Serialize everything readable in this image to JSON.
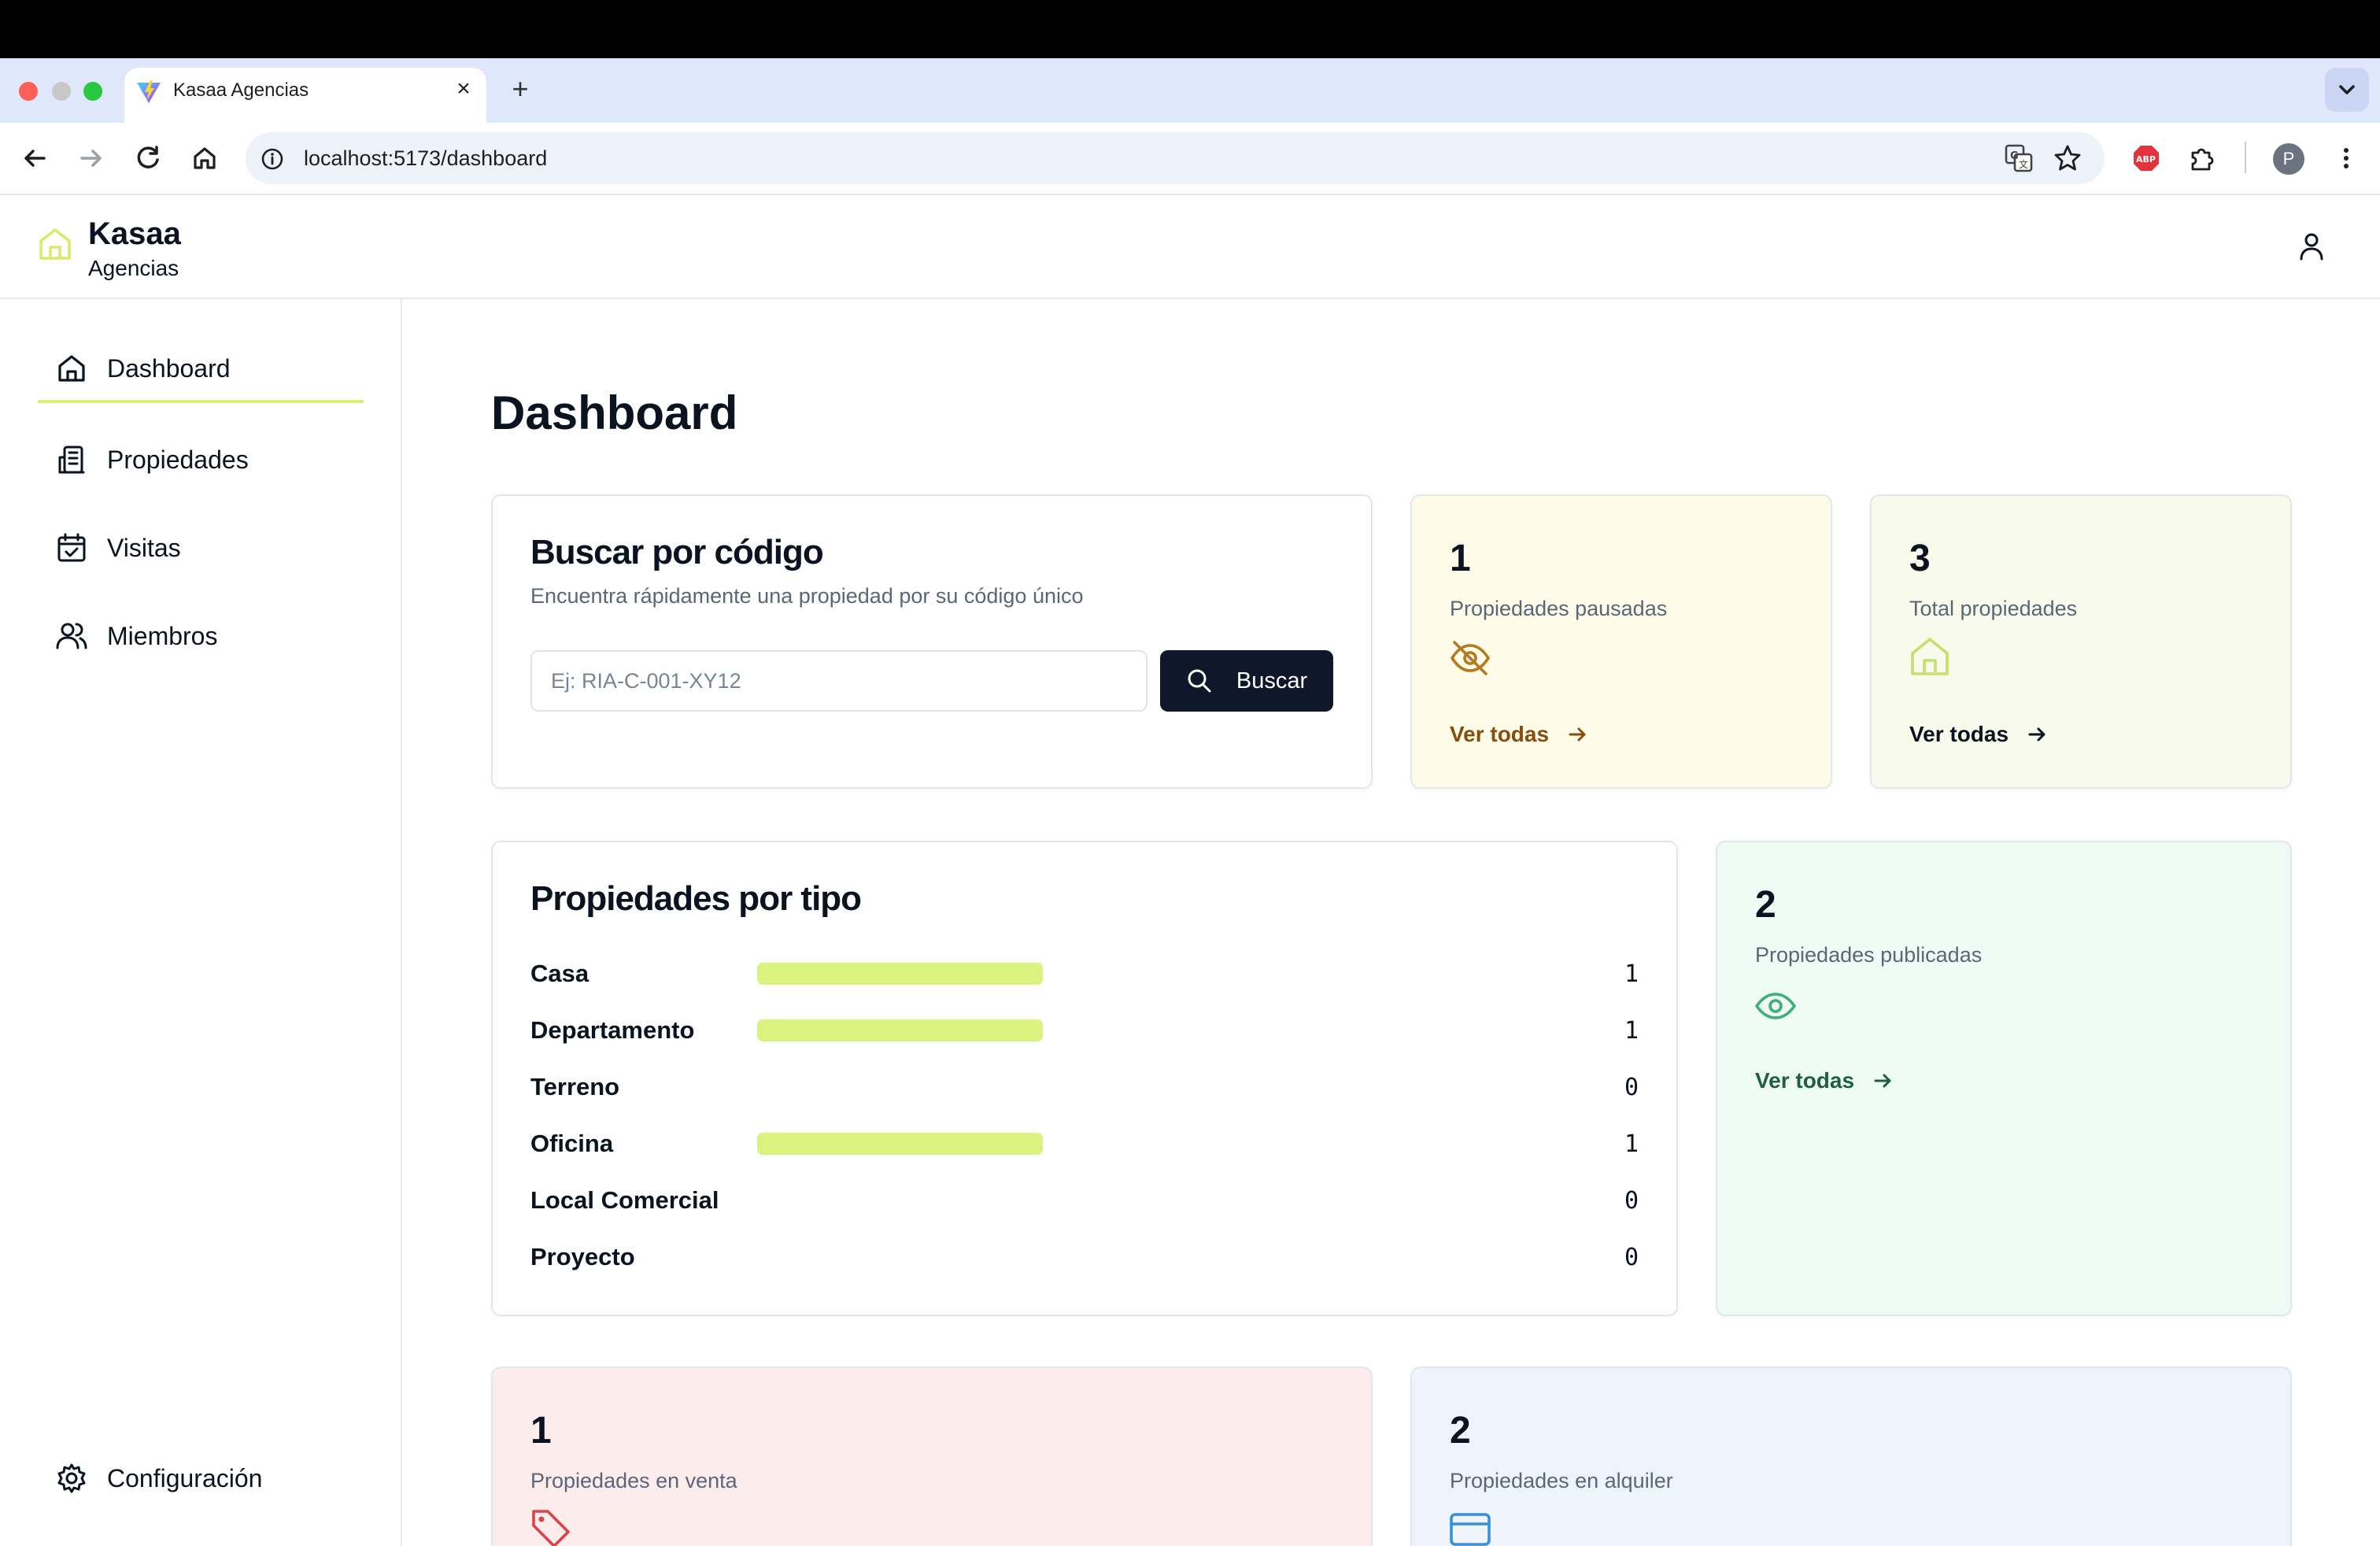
{
  "browser": {
    "tab_title": "Kasaa Agencias",
    "tab_close": "×",
    "new_tab": "+",
    "url": "localhost:5173/dashboard",
    "profile_initial": "P"
  },
  "app": {
    "name": "Kasaa",
    "subtitle": "Agencias"
  },
  "sidebar": {
    "items": [
      {
        "label": "Dashboard",
        "icon": "home-icon",
        "active": true
      },
      {
        "label": "Propiedades",
        "icon": "building-icon"
      },
      {
        "label": "Visitas",
        "icon": "calendar-check-icon"
      },
      {
        "label": "Miembros",
        "icon": "users-icon"
      }
    ],
    "settings_label": "Configuración"
  },
  "main": {
    "title": "Dashboard",
    "search": {
      "title": "Buscar por código",
      "subtitle": "Encuentra rápidamente una propiedad por su código único",
      "placeholder": "Ej: RIA-C-001-XY12",
      "value": "",
      "button_label": "Buscar"
    },
    "stats": {
      "paused": {
        "value": "1",
        "label": "Propiedades pausadas",
        "link": "Ver todas",
        "bg": "#fefce8",
        "accent": "#b7791f",
        "link_color": "#854d0e"
      },
      "total": {
        "value": "3",
        "label": "Total propiedades",
        "link": "Ver todas",
        "bg": "#f8fbec",
        "accent": "#c7e06a",
        "link_color": "#0b1220"
      },
      "published": {
        "value": "2",
        "label": "Propiedades publicadas",
        "link": "Ver todas",
        "bg": "#eefbf4",
        "accent": "#3fae78",
        "link_color": "#1f5e44"
      },
      "sale": {
        "value": "1",
        "label": "Propiedades en venta",
        "bg": "#fdecec",
        "accent": "#d9434a"
      },
      "rent": {
        "value": "2",
        "label": "Propiedades en alquiler",
        "bg": "#edf4fc",
        "accent": "#3b8fd9"
      }
    },
    "types": {
      "title": "Propiedades por tipo",
      "bar_color": "#dbf27e",
      "rows": [
        {
          "name": "Casa",
          "count": "1",
          "fraction": 0.333
        },
        {
          "name": "Departamento",
          "count": "1",
          "fraction": 0.333
        },
        {
          "name": "Terreno",
          "count": "0",
          "fraction": 0
        },
        {
          "name": "Oficina",
          "count": "1",
          "fraction": 0.333
        },
        {
          "name": "Local Comercial",
          "count": "0",
          "fraction": 0
        },
        {
          "name": "Proyecto",
          "count": "0",
          "fraction": 0
        }
      ]
    }
  }
}
